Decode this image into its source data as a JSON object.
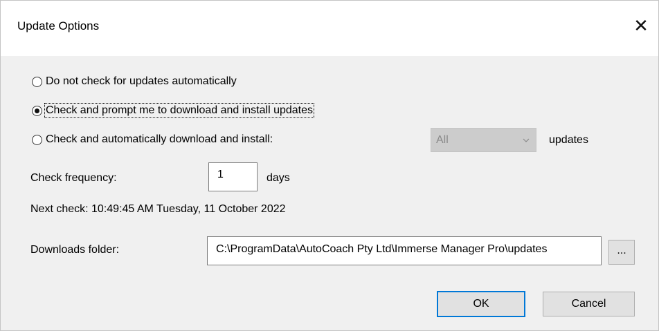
{
  "window": {
    "title": "Update Options",
    "close_glyph": "✕"
  },
  "options": [
    {
      "label": "Do not check for updates automatically",
      "checked": false
    },
    {
      "label": "Check and prompt me to download and install updates",
      "checked": true
    },
    {
      "label": "Check and automatically download and install:",
      "checked": false
    }
  ],
  "auto_install": {
    "selected": "All",
    "suffix": "updates",
    "disabled": true
  },
  "frequency": {
    "label": "Check frequency:",
    "value": "1",
    "unit": "days"
  },
  "next_check": "Next check: 10:49:45 AM Tuesday, 11 October 2022",
  "downloads": {
    "label": "Downloads folder:",
    "path": "C:\\ProgramData\\AutoCoach Pty Ltd\\Immerse Manager Pro\\updates",
    "browse_label": "..."
  },
  "buttons": {
    "ok": "OK",
    "cancel": "Cancel"
  }
}
